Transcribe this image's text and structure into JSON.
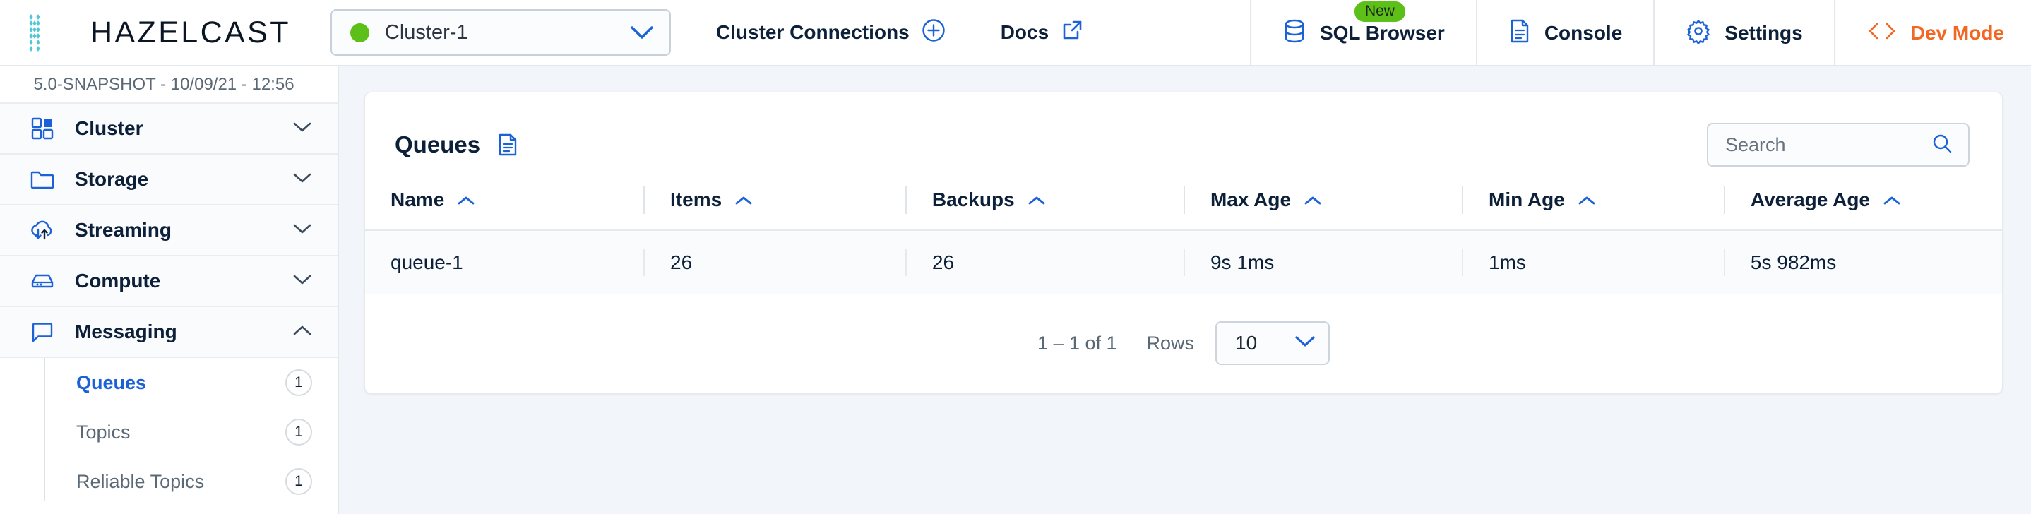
{
  "brand": {
    "name": "HAZELCAST",
    "logo_icon": "hazelcast-logo-icon"
  },
  "topbar": {
    "cluster_selector": {
      "value": "Cluster-1",
      "status_color": "#5cc018",
      "chevron_icon": "chevron-down-icon"
    },
    "links": [
      {
        "label": "Cluster Connections",
        "icon": "plus-circle-icon"
      },
      {
        "label": "Docs",
        "icon": "external-link-icon"
      }
    ],
    "right_items": [
      {
        "label": "SQL Browser",
        "icon": "database-icon",
        "badge": "New",
        "badge_color": "#5cc018"
      },
      {
        "label": "Console",
        "icon": "console-document-icon"
      },
      {
        "label": "Settings",
        "icon": "gear-icon"
      },
      {
        "label": "Dev Mode",
        "icon": "code-brackets-icon",
        "color": "#f26722"
      }
    ]
  },
  "sidebar": {
    "version": "5.0-SNAPSHOT - 10/09/21 - 12:56",
    "groups": [
      {
        "label": "Cluster",
        "icon": "grid-icon",
        "chevron": "chevron-down-icon"
      },
      {
        "label": "Storage",
        "icon": "folder-icon",
        "chevron": "chevron-down-icon"
      },
      {
        "label": "Streaming",
        "icon": "cloud-streaming-icon",
        "chevron": "chevron-down-icon"
      },
      {
        "label": "Compute",
        "icon": "server-icon",
        "chevron": "chevron-down-icon"
      },
      {
        "label": "Messaging",
        "icon": "speech-bubble-icon",
        "chevron": "chevron-up-icon"
      }
    ],
    "messaging_items": [
      {
        "label": "Queues",
        "count": "1",
        "active": true
      },
      {
        "label": "Topics",
        "count": "1",
        "active": false
      },
      {
        "label": "Reliable Topics",
        "count": "1",
        "active": false
      }
    ]
  },
  "main": {
    "title": "Queues",
    "title_icon": "document-icon",
    "search": {
      "placeholder": "Search",
      "value": "",
      "icon": "search-icon"
    },
    "table": {
      "columns": [
        {
          "label": "Name",
          "sort_icon": "chevron-up-icon"
        },
        {
          "label": "Items",
          "sort_icon": "chevron-up-icon"
        },
        {
          "label": "Backups",
          "sort_icon": "chevron-up-icon"
        },
        {
          "label": "Max Age",
          "sort_icon": "chevron-up-icon"
        },
        {
          "label": "Min Age",
          "sort_icon": "chevron-up-icon"
        },
        {
          "label": "Average Age",
          "sort_icon": "chevron-up-icon"
        }
      ],
      "rows": [
        {
          "name": "queue-1",
          "items": "26",
          "backups": "26",
          "max_age": "9s 1ms",
          "min_age": "1ms",
          "average_age": "5s 982ms"
        }
      ]
    },
    "pagination": {
      "range": "1 – 1 of 1",
      "rows_label": "Rows",
      "rows_per_page": "10",
      "chevron_icon": "chevron-down-icon"
    }
  },
  "colors": {
    "accent_blue": "#1a62d6",
    "navy": "#0d2039",
    "orange": "#f26722",
    "green": "#5cc018",
    "logo_cyan": "#4ec7d9"
  }
}
